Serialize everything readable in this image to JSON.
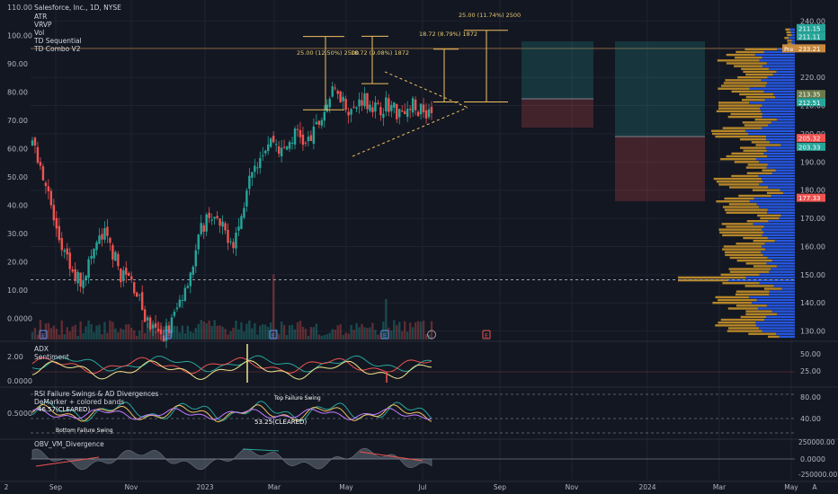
{
  "header": {
    "symbol": "Salesforce, Inc., 1D, NYSE",
    "indicators": [
      "ATR",
      "VRVP",
      "Vol",
      "TD Sequential",
      "TD Combo V2"
    ]
  },
  "colors": {
    "bg": "#131722",
    "grid": "#1f2331",
    "up": "#26a69a",
    "down": "#ef5350",
    "profile_orange": "#c8922a",
    "profile_blue": "#2962ff",
    "measure": "#f0c060",
    "axis_text": "#b2b5be"
  },
  "chart_data": [
    {
      "type": "candlestick",
      "panel": "main",
      "x_labels": [
        "2",
        "Sep",
        "Nov",
        "2023",
        "Mar",
        "May",
        "Jul",
        "Sep",
        "Nov",
        "2024",
        "Mar",
        "May",
        "A"
      ],
      "y_ticks_right": [
        "240.00",
        "230.00",
        "220.00",
        "210.00",
        "200.00",
        "190.00",
        "180.00",
        "170.00",
        "160.00",
        "150.00",
        "140.00",
        "130.00"
      ],
      "y_ticks_left": [
        "110.00",
        "100.00",
        "90.00",
        "80.00",
        "70.00",
        "60.00",
        "50.00",
        "40.00",
        "30.00",
        "20.00",
        "10.00",
        "0.0000"
      ],
      "ylim": [
        127,
        243
      ],
      "close_path": [
        [
          0,
          196
        ],
        [
          3,
          190
        ],
        [
          6,
          178
        ],
        [
          9,
          165
        ],
        [
          12,
          157
        ],
        [
          15,
          150
        ],
        [
          18,
          148
        ],
        [
          21,
          154
        ],
        [
          24,
          161
        ],
        [
          27,
          164
        ],
        [
          30,
          158
        ],
        [
          33,
          150
        ],
        [
          36,
          149
        ],
        [
          39,
          144
        ],
        [
          42,
          135
        ],
        [
          45,
          130
        ],
        [
          48,
          128
        ],
        [
          51,
          131
        ],
        [
          54,
          138
        ],
        [
          57,
          146
        ],
        [
          60,
          154
        ],
        [
          63,
          166
        ],
        [
          66,
          172
        ],
        [
          69,
          168
        ],
        [
          72,
          165
        ],
        [
          75,
          162
        ],
        [
          78,
          170
        ],
        [
          81,
          188
        ],
        [
          84,
          191
        ],
        [
          87,
          196
        ],
        [
          90,
          198
        ],
        [
          93,
          193
        ],
        [
          96,
          197
        ],
        [
          99,
          201
        ],
        [
          102,
          196
        ],
        [
          105,
          200
        ],
        [
          108,
          206
        ],
        [
          111,
          213
        ],
        [
          114,
          216
        ],
        [
          117,
          210
        ],
        [
          120,
          208
        ],
        [
          123,
          213
        ],
        [
          126,
          211
        ],
        [
          129,
          208
        ],
        [
          132,
          211
        ],
        [
          135,
          209
        ]
      ],
      "price_labels": [
        "233.21",
        "213.35",
        "212.51",
        "211.15",
        "211.11",
        "205.32",
        "203.33",
        "177.33"
      ],
      "price_label_text": "Pre",
      "measurements": [
        "25.00 (12.50%) 2500",
        "18.72 (9.08%) 1872",
        "18.72 (8.79%) 1872",
        "25.00 (11.74%) 2500"
      ]
    },
    {
      "type": "line",
      "panel": "adx",
      "labels": [
        "ADX",
        "Sentiment"
      ],
      "y_ticks_left": [
        "2.00",
        "0.0000"
      ],
      "y_ticks_right": [
        "50.00",
        "25.00"
      ]
    },
    {
      "type": "line",
      "panel": "rsi",
      "labels": [
        "RSI Failure Swings & AD Divergences",
        "DeMarker + colored bands"
      ],
      "y_ticks_left": [
        "0.5000"
      ],
      "y_ticks_right": [
        "80.00",
        "40.00"
      ],
      "annotations": [
        "46.57(CLEARED)",
        "53.25(CLEARED)",
        "Top Failure Swing",
        "Bottom Failure Swing"
      ]
    },
    {
      "type": "area",
      "panel": "obv",
      "labels": [
        "OBV_VM_Divergence"
      ],
      "y_ticks_right": [
        "250000.00",
        "0.0000",
        "-250000.00"
      ]
    }
  ]
}
